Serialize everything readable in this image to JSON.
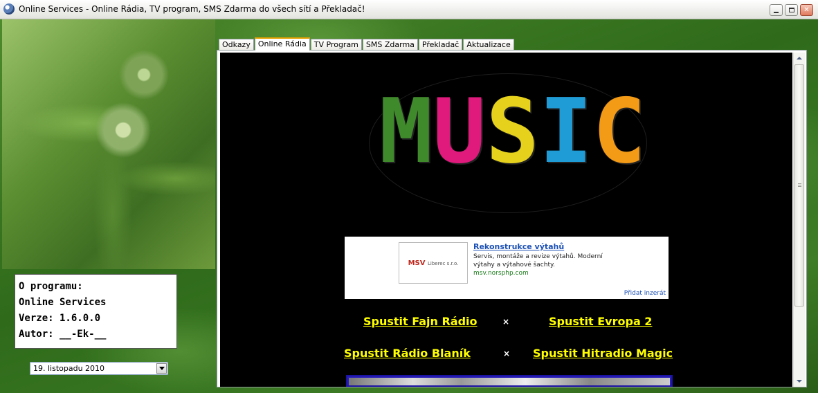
{
  "window": {
    "title": "Online Services - Online Rádia, TV program, SMS Zdarma do všech sítí a Překladač!"
  },
  "about": {
    "lines": [
      "O programu:",
      "Online Services",
      "Verze: 1.6.0.0",
      "Autor: __-Ek-__"
    ]
  },
  "date_picker": {
    "value": "19. listopadu 2010"
  },
  "tabs": [
    {
      "label": "Odkazy",
      "active": false
    },
    {
      "label": "Online Rádia",
      "active": true
    },
    {
      "label": "TV Program",
      "active": false
    },
    {
      "label": "SMS Zdarma",
      "active": false
    },
    {
      "label": "Překladač",
      "active": false
    },
    {
      "label": "Aktualizace",
      "active": false
    }
  ],
  "music": {
    "letters": [
      "M",
      "U",
      "S",
      "I",
      "C"
    ],
    "colors": [
      "#3f8a2a",
      "#e0197d",
      "#e6d21c",
      "#1f9bd6",
      "#f39a16"
    ]
  },
  "ad": {
    "logo_text": "MSV",
    "logo_sub": "Liberec s.r.o.",
    "title": "Rekonstrukce výtahů",
    "description": "Servis, montáže a revize výtahů. Moderní výtahy a výtahové šachty.",
    "url": "msv.norsphp.com",
    "add_label": "Přidat inzerát"
  },
  "radios": {
    "row1_left": "Spustit Fajn Rádio",
    "row1_right": "Spustit Evropa 2",
    "row2_left": "Spustit Rádio Blaník",
    "row2_right": "Spustit Hitradio Magic",
    "separator": "×"
  },
  "icons": {
    "app": "app-globe-icon",
    "minimize": "minimize-icon",
    "maximize": "maximize-icon",
    "close": "close-icon"
  },
  "colors": {
    "link_yellow": "#ffff00",
    "tab_active_accent": "#e6a100",
    "page_background": "#000000"
  }
}
